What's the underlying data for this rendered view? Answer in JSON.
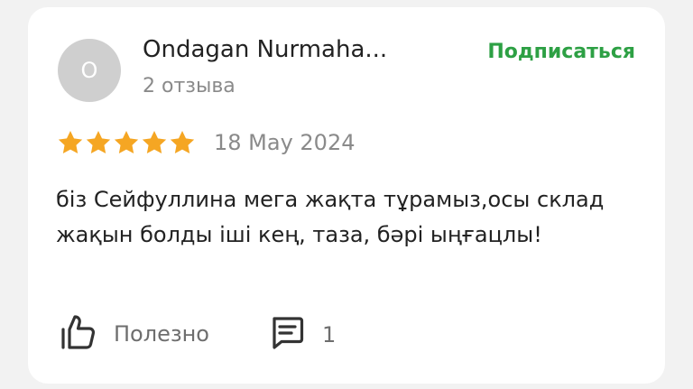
{
  "author": {
    "avatar_letter": "O",
    "name": "Ondagan Nurmaha...",
    "reviews_count": "2 отзыва"
  },
  "subscribe_label": "Подписаться",
  "rating": {
    "stars": 5,
    "max_stars": 5,
    "star_color": "#f5a623"
  },
  "date": "18 May 2024",
  "review_text": "біз Сейфуллина мега жақта тұрамыз,осы склад жақын болды іші кең, таза, бәрі ыңғацлы!",
  "actions": {
    "like_label": "Полезно",
    "like_icon": "thumbs-up-icon",
    "comment_icon": "comment-icon",
    "comments_count": "1"
  },
  "colors": {
    "accent_green": "#2da044",
    "secondary_text": "#8a8a8a"
  }
}
